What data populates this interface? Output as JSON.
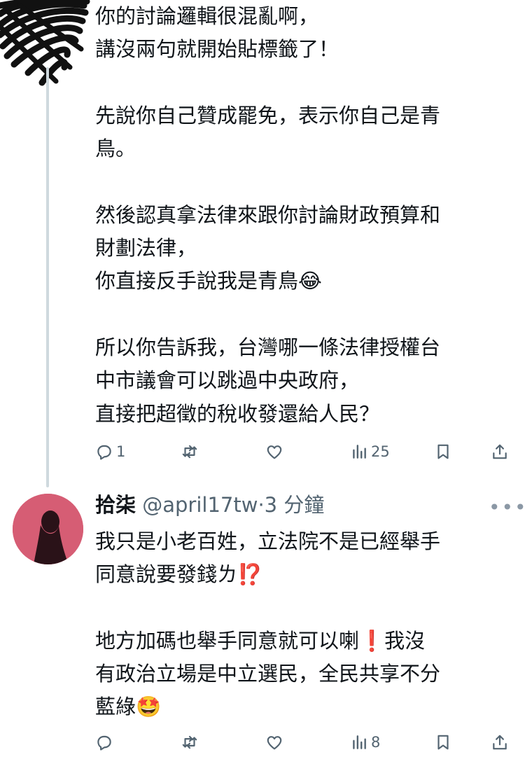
{
  "tweets": [
    {
      "lines": [
        "你的討論邏輯很混亂啊，",
        "講沒兩句就開始貼標籤了！",
        "",
        "先說你自己贊成罷免，表示你自己是青",
        "鳥。",
        "",
        "然後認真拿法律來跟你討論財政預算和",
        "財劃法律，",
        "你直接反手說我是青鳥😂",
        "",
        "所以你告訴我，台灣哪一條法律授權台",
        "中市議會可以跳過中央政府，",
        "直接把超徵的稅收發還給人民？"
      ],
      "actions": {
        "reply_count": "1",
        "repost_count": "",
        "like_count": "",
        "views_count": "25"
      }
    },
    {
      "author": {
        "name": "拾柒",
        "handle": "@april17tw",
        "separator": "·",
        "time": "3 分鐘"
      },
      "more_label": "•••",
      "lines": [
        "我只是小老百姓，立法院不是已經舉手",
        "同意說要發錢ㄌ⁉️",
        "",
        "地方加碼也舉手同意就可以喇❗️我沒",
        "有政治立場是中立選民，全民共享不分",
        "藍綠🤩"
      ],
      "actions": {
        "reply_count": "",
        "repost_count": "",
        "like_count": "",
        "views_count": "8"
      }
    }
  ],
  "icons": {
    "reply": "reply-icon",
    "repost": "repost-icon",
    "like": "heart-icon",
    "views": "views-icon",
    "bookmark": "bookmark-icon",
    "share": "share-icon",
    "more": "more-icon"
  },
  "colors": {
    "text": "#0f1419",
    "muted": "#536471",
    "thread_line": "#cfd9de",
    "avatar_bg": "#d65d74",
    "emoji_red": "#e0242e"
  }
}
